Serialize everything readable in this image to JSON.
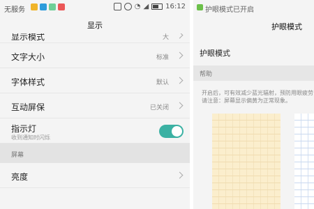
{
  "left": {
    "status_bar": {
      "carrier": "无服务",
      "app_icon_colors": [
        "#f0b429",
        "#2d9cdb",
        "#6fcf97",
        "#eb5757"
      ],
      "time": "16:12"
    },
    "title": "显示",
    "items": [
      {
        "label": "显示模式",
        "value": "大"
      },
      {
        "label": "文字大小",
        "value": "标准"
      },
      {
        "label": "字体样式",
        "value": "默认"
      },
      {
        "label": "互动屏保",
        "value": "已关闭"
      },
      {
        "label": "指示灯",
        "sub": "收到通知时闪烁",
        "toggle_on": true
      }
    ],
    "section": "屏幕",
    "section_items": [
      {
        "label": "亮度"
      }
    ]
  },
  "right": {
    "status_bar": {
      "text": "护眼模式已开启",
      "icon_color": "#6cc04a"
    },
    "title": "护眼模式",
    "item": "护眼模式",
    "section": "帮助",
    "help_line1": "开启后，可有效减少蓝光辐射，预防用眼疲劳",
    "help_line2": "请注意：屏幕显示偏黄为正常现象。"
  },
  "colors": {
    "accent": "#3bb1a3",
    "section_bg": "#e3e3e3"
  }
}
